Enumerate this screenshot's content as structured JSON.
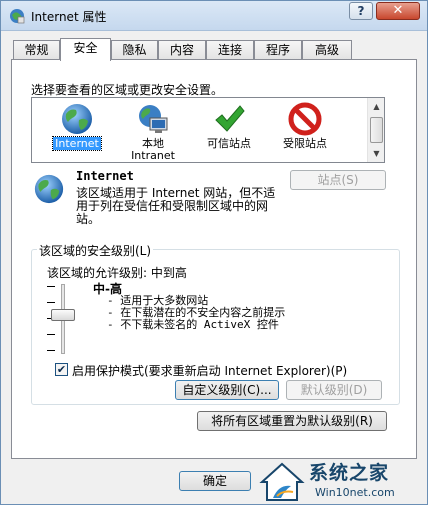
{
  "window": {
    "title": "Internet 属性",
    "help_label": "?",
    "close_label": "✕"
  },
  "tabs": [
    "常规",
    "安全",
    "隐私",
    "内容",
    "连接",
    "程序",
    "高级"
  ],
  "active_tab": "安全",
  "security": {
    "prompt": "选择要查看的区域或更改安全设置。",
    "zones": [
      {
        "label": "Internet",
        "icon": "globe-icon"
      },
      {
        "label": "本地\nIntranet",
        "icon": "local-intranet-icon"
      },
      {
        "label": "可信站点",
        "icon": "checkmark-icon"
      },
      {
        "label": "受限站点",
        "icon": "no-entry-icon"
      }
    ],
    "selected_zone": {
      "name": "Internet",
      "description": "该区域适用于 Internet 网站，但不适用于列在受信任和受限制区域中的网站。",
      "sites_button": "站点(S)"
    },
    "level_group_title": "该区域的安全级别(L)",
    "allowed_levels": "该区域的允许级别: 中到高",
    "level_name": "中-高",
    "level_desc": [
      "- 适用于大多数网站",
      "- 在下载潜在的不安全内容之前提示",
      "- 不下载未签名的 ActiveX 控件"
    ],
    "protected_mode_label": "启用保护模式(要求重新启动 Internet Explorer)(P)",
    "protected_mode_checked": true,
    "custom_level_button": "自定义级别(C)...",
    "default_level_button": "默认级别(D)",
    "reset_all_button": "将所有区域重置为默认级别(R)"
  },
  "footer": {
    "ok_button": "确定"
  },
  "watermark": {
    "title": "系统之家",
    "url": "Win10net.com"
  },
  "colors": {
    "selection": "#3399ff",
    "title_gradient_top": "#dbe8f6",
    "watermark": "#18466b"
  }
}
